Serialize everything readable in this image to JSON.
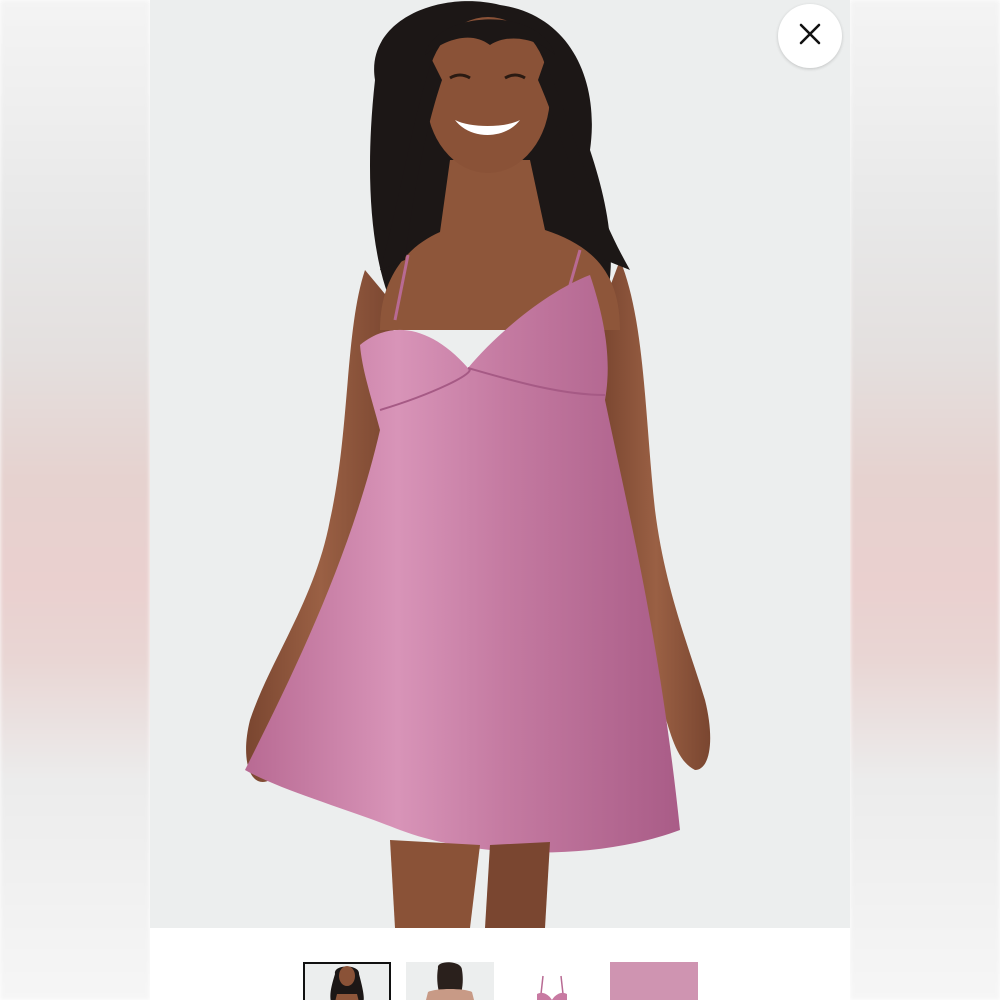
{
  "viewer": {
    "close_label": "Close",
    "selected_thumbnail": 1,
    "thumbnails": [
      {
        "name": "front-view"
      },
      {
        "name": "back-view"
      },
      {
        "name": "flat-lay"
      },
      {
        "name": "fabric-swatch"
      }
    ]
  },
  "colors": {
    "dress": "#c87aa2",
    "background": "#eceeee",
    "hair": "#1c1716",
    "skin": "#8a5237"
  }
}
